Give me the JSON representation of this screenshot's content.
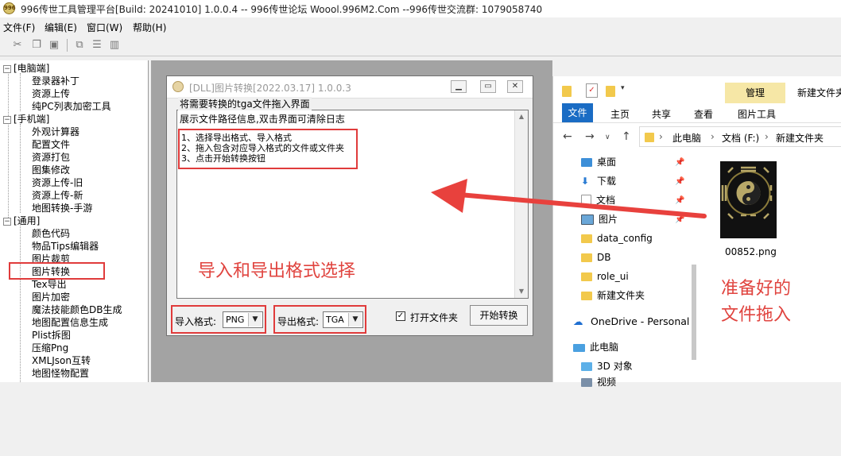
{
  "titlebar": {
    "logo_text": "996",
    "title": "996传世工具管理平台[Build: 20241010] 1.0.0.4 -- 996传世论坛  Woool.996M2.Com --996传世交流群:  1079058740"
  },
  "menubar": {
    "items": [
      "文件(F)",
      "编辑(E)",
      "窗口(W)",
      "帮助(H)"
    ]
  },
  "tree": {
    "categories": [
      {
        "label": "[电脑端]",
        "items": [
          "登录器补丁",
          "资源上传",
          "纯PC列表加密工具"
        ]
      },
      {
        "label": "[手机端]",
        "items": [
          "外观计算器",
          "配置文件",
          "资源打包",
          "图集修改",
          "资源上传-旧",
          "资源上传-新",
          "地图转换-手游"
        ]
      },
      {
        "label": "[通用]",
        "items": [
          "颜色代码",
          "物品Tips编辑器",
          "图片裁剪",
          "图片转换",
          "Tex导出",
          "图片加密",
          "魔法技能颜色DB生成",
          "地图配置信息生成",
          "Plist拆图",
          "压缩Png",
          "XMLJson互转",
          "地图怪物配置"
        ]
      }
    ]
  },
  "dll_window": {
    "title": "[DLL]图片转换[2022.03.17] 1.0.0.3",
    "group_label": "将需要转换的tga文件拖入界面",
    "log_line": "展示文件路径信息,双击界面可清除日志",
    "instructions": [
      "1、选择导出格式、导入格式",
      "2、拖入包含对应导入格式的文件或文件夹",
      "3、点击开始转换按钮"
    ],
    "import_label": "导入格式:",
    "import_value": "PNG",
    "export_label": "导出格式:",
    "export_value": "TGA",
    "open_folder_label": "打开文件夹",
    "open_folder_checked": true,
    "start_label": "开始转换"
  },
  "annotations": {
    "format_select": "导入和导出格式选择",
    "ready_line1": "准备好的",
    "ready_line2": "文件拖入",
    "accent_color": "#e0443f"
  },
  "explorer": {
    "manage_tab": "管理",
    "window_title": "新建文件夹",
    "ribbon_tabs": [
      "文件",
      "主页",
      "共享",
      "查看",
      "图片工具"
    ],
    "breadcrumb": [
      "此电脑",
      "文档 (F:)",
      "新建文件夹"
    ],
    "nav_items": [
      "桌面",
      "下载",
      "文档",
      "图片",
      "data_config",
      "DB",
      "role_ui",
      "新建文件夹",
      "OneDrive - Personal",
      "此电脑",
      "3D 对象",
      "视频"
    ],
    "file_name": "00852.png"
  }
}
